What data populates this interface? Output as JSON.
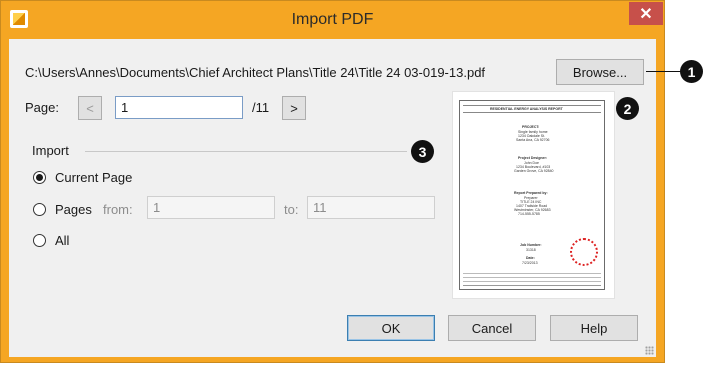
{
  "window": {
    "title": "Import PDF",
    "close_symbol": "✕",
    "accent": "#f5a623",
    "close_color": "#c7504a"
  },
  "file": {
    "path": "C:\\Users\\Annes\\Documents\\Chief Architect Plans\\Title 24\\Title 24 03-019-13.pdf",
    "browse_label": "Browse..."
  },
  "page": {
    "label": "Page:",
    "prev_label": "<",
    "value": "1",
    "total": "/11",
    "next_label": ">"
  },
  "import_group": {
    "title": "Import",
    "options": {
      "current": "Current Page",
      "pages": "Pages",
      "all": "All"
    },
    "selected": "Current Page",
    "from_label": "from:",
    "from_value": "1",
    "to_label": "to:",
    "to_value": "11"
  },
  "preview_doc": {
    "header": "RESIDENTIAL ENERGY ANALYSIS REPORT",
    "project_label": "PROJECT:",
    "project_lines": [
      "Single family home",
      "1234 Oakdale St.",
      "Santa Ana, CA 92706"
    ],
    "designer_label": "Project Designer:",
    "designer_lines": [
      "John Doe",
      "1234 Boulevard, #103",
      "Garden Grove, CA 92840"
    ],
    "preparer_label": "Report Prepared by:",
    "preparer_lines": [
      "Preparer",
      "TITLE 24 INC",
      "1407 Trailside Road",
      "Westminster, CA 92683",
      "714-555-5785"
    ],
    "job_label": "Job Number:",
    "job_value": "31318",
    "date_label": "Date:",
    "date_value": "7/23/2013"
  },
  "buttons": {
    "ok": "OK",
    "cancel": "Cancel",
    "help": "Help"
  },
  "callouts": [
    "1",
    "2",
    "3"
  ]
}
